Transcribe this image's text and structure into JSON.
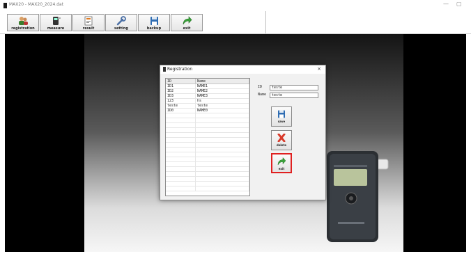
{
  "window": {
    "title": "MAX20 - MAX20_2024.dat",
    "minimize": "—",
    "maximize": "▢"
  },
  "toolbar": [
    {
      "label": "registration",
      "icon": "people-icon"
    },
    {
      "label": "measure",
      "icon": "device-icon"
    },
    {
      "label": "result",
      "icon": "report-icon"
    },
    {
      "label": "setting",
      "icon": "wrench-icon"
    },
    {
      "label": "backup",
      "icon": "floppy-icon"
    },
    {
      "label": "exit",
      "icon": "exit-arrow-icon"
    }
  ],
  "dialog": {
    "title": "Registration",
    "close": "×",
    "table": {
      "columns": [
        "ID",
        "Name"
      ],
      "rows": [
        [
          "ID1",
          "NAME1"
        ],
        [
          "ID2",
          "NAME2"
        ],
        [
          "ID3",
          "NAME3"
        ],
        [
          "123",
          "hs"
        ],
        [
          "teste",
          "teste"
        ],
        [
          "ID0",
          "NAME0"
        ]
      ]
    },
    "id_label": "ID",
    "id_value": "teste",
    "name_label": "Name",
    "name_value": "teste",
    "buttons": {
      "save": "save",
      "delete": "delete",
      "exit": "exit"
    }
  },
  "colors": {
    "exit_highlight": "#e02020",
    "background": "#000000"
  }
}
